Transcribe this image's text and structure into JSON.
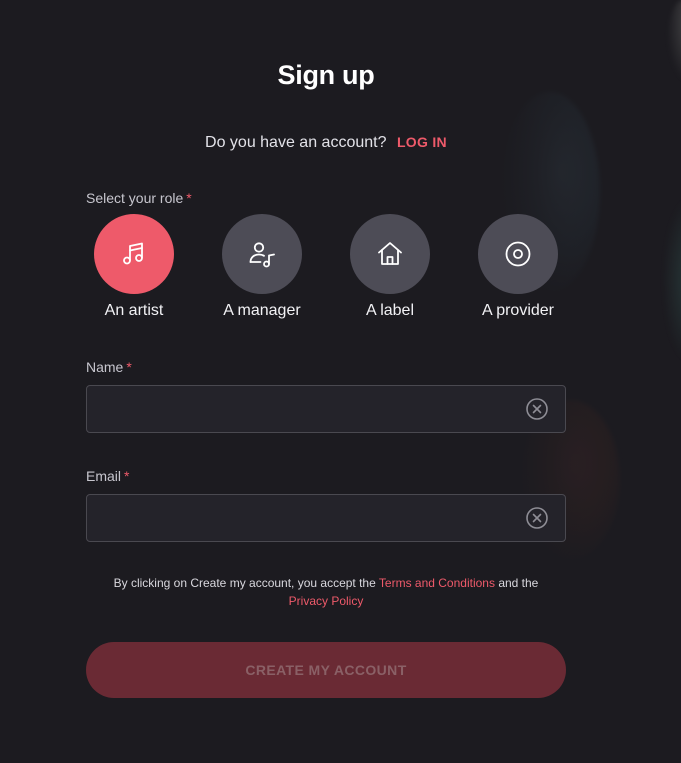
{
  "page": {
    "title": "Sign up",
    "account_prompt": "Do you have an account?",
    "login_label": "LOG IN"
  },
  "roles": {
    "label": "Select your role",
    "required_mark": "*",
    "selected": "An artist",
    "items": [
      {
        "label": "An artist",
        "icon": "music-note-icon"
      },
      {
        "label": "A manager",
        "icon": "person-music-icon"
      },
      {
        "label": "A label",
        "icon": "house-icon"
      },
      {
        "label": "A provider",
        "icon": "disc-icon"
      }
    ]
  },
  "fields": {
    "name": {
      "label": "Name",
      "required_mark": "*",
      "value": "",
      "placeholder": ""
    },
    "email": {
      "label": "Email",
      "required_mark": "*",
      "value": "",
      "placeholder": ""
    }
  },
  "terms": {
    "prefix": "By clicking on Create my account, you accept the",
    "terms_link": "Terms and Conditions",
    "conjunction": "and the",
    "privacy_link": "Privacy Policy"
  },
  "actions": {
    "create_label": "CREATE MY ACCOUNT"
  },
  "colors": {
    "background": "#1c1b20",
    "accent": "#ee5a6a",
    "role_inactive": "#4d4c56",
    "button_disabled": "#6a2a34"
  }
}
